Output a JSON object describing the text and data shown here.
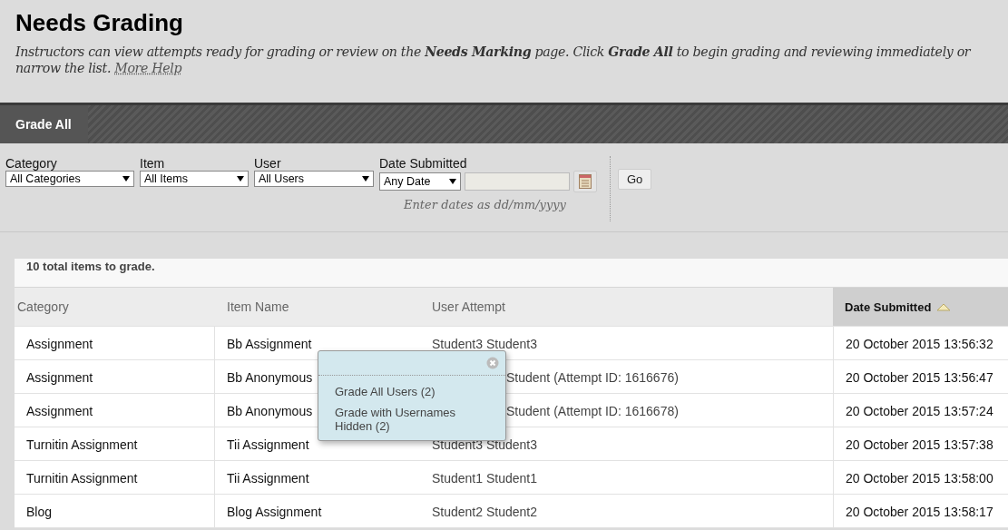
{
  "page": {
    "title": "Needs Grading",
    "description": "Instructors can view attempts ready for grading or review on the **Needs Marking** page. Click **Grade All** to begin grading and reviewing immediately or",
    "description_2": "narrow the list.",
    "help_link": "More Help"
  },
  "action_bar": {
    "buttons": [
      {
        "label": "Grade All",
        "selected": true
      }
    ]
  },
  "filters": [
    {
      "label": "Category",
      "value": "All Categories"
    },
    {
      "label": "Item",
      "value": "All Items"
    },
    {
      "label": "User",
      "value": "All Users"
    }
  ],
  "date_filter": {
    "label": "Date Submitted",
    "value": "Any Date",
    "hint": "Enter dates as dd/mm/yyyy"
  },
  "go_button": "Go",
  "summary": "10 total items to grade.",
  "table": {
    "columns": [
      {
        "label": "Category",
        "sorted": false
      },
      {
        "label": "Item Name",
        "sorted": false
      },
      {
        "label": "User Attempt",
        "sorted": false
      },
      {
        "label": "Date Submitted",
        "sorted": true
      }
    ],
    "rows": [
      {
        "kind": "plain",
        "cells": [
          "Assignment",
          "Bb Assignment",
          "Student3 Student3",
          "20 October 2015 13:56:32"
        ]
      },
      {
        "kind": "under_popup",
        "cells": [
          "Assignment",
          "Bb Anonymous",
          "Student (Attempt ID: 1616676)",
          "20 October 2015 13:56:47"
        ]
      },
      {
        "kind": "under_popup",
        "cells": [
          "Assignment",
          "Bb Anonymous",
          "Student (Attempt ID: 1616678)",
          "20 October 2015 13:57:24"
        ]
      },
      {
        "kind": "plain",
        "cells": [
          "Turnitin Assignment",
          "Tii Assignment",
          "Student3 Student3",
          "20 October 2015 13:57:38"
        ]
      },
      {
        "kind": "plain",
        "cells": [
          "Turnitin Assignment",
          "Tii Assignment",
          "Student1 Student1",
          "20 October 2015 13:58:00"
        ]
      },
      {
        "kind": "plain",
        "cells": [
          "Blog",
          "Blog Assignment",
          "Student2 Student2",
          "20 October 2015 13:58:17"
        ]
      }
    ]
  },
  "popup_menu": {
    "items": [
      "Grade All Users (2)",
      "Grade with Usernames Hidden (2)"
    ]
  }
}
